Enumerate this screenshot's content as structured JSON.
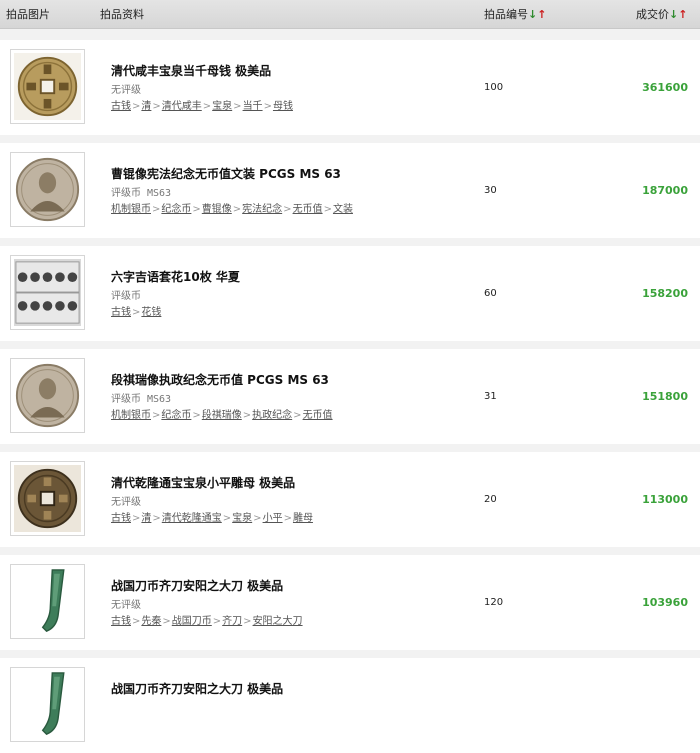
{
  "header": {
    "image_col": "拍品图片",
    "info_col": "拍品资料",
    "lot_col": "拍品编号",
    "price_col": "成交价",
    "sort_down": "↓",
    "sort_up": "↑"
  },
  "items": [
    {
      "title": "清代咸丰宝泉当千母钱 极美品",
      "grade": "无评级",
      "grade_code": "",
      "lot": "100",
      "price": "361600",
      "thumb": "square-hole-coin-icon",
      "tags": [
        "古钱",
        "清",
        "清代咸丰",
        "宝泉",
        "当千",
        "母钱"
      ]
    },
    {
      "title": "曹锟像宪法纪念无币值文装 PCGS MS 63",
      "grade": "评级币",
      "grade_code": "MS63",
      "lot": "30",
      "price": "187000",
      "thumb": "silver-dollar-portrait-icon",
      "tags": [
        "机制银币",
        "纪念币",
        "曹锟像",
        "宪法纪念",
        "无币值",
        "文装"
      ]
    },
    {
      "title": "六字吉语套花10枚 华夏",
      "grade": "评级币",
      "grade_code": "",
      "lot": "60",
      "price": "158200",
      "thumb": "slabbed-coin-set-icon",
      "tags": [
        "古钱",
        "花钱"
      ]
    },
    {
      "title": "段祺瑞像执政纪念无币值 PCGS MS 63",
      "grade": "评级币",
      "grade_code": "MS63",
      "lot": "31",
      "price": "151800",
      "thumb": "silver-dollar-portrait-icon",
      "tags": [
        "机制银币",
        "纪念币",
        "段祺瑞像",
        "执政纪念",
        "无币值"
      ]
    },
    {
      "title": "清代乾隆通宝宝泉小平雕母 极美品",
      "grade": "无评级",
      "grade_code": "",
      "lot": "20",
      "price": "113000",
      "thumb": "bronze-square-hole-coin-icon",
      "tags": [
        "古钱",
        "清",
        "清代乾隆通宝",
        "宝泉",
        "小平",
        "雕母"
      ]
    },
    {
      "title": "战国刀币齐刀安阳之大刀 极美品",
      "grade": "无评级",
      "grade_code": "",
      "lot": "120",
      "price": "103960",
      "thumb": "knife-money-icon",
      "tags": [
        "古钱",
        "先秦",
        "战国刀币",
        "齐刀",
        "安阳之大刀"
      ]
    },
    {
      "title": "战国刀币齐刀安阳之大刀 极美品",
      "grade": "",
      "grade_code": "",
      "lot": "",
      "price": "",
      "thumb": "knife-money-icon",
      "tags": []
    }
  ],
  "colors": {
    "price": "#3aa23a",
    "sort_down": "#2e8b2e",
    "sort_up": "#cc1f1f",
    "header_bg": "#dcdcdc",
    "page_bg": "#f2f2f2"
  }
}
